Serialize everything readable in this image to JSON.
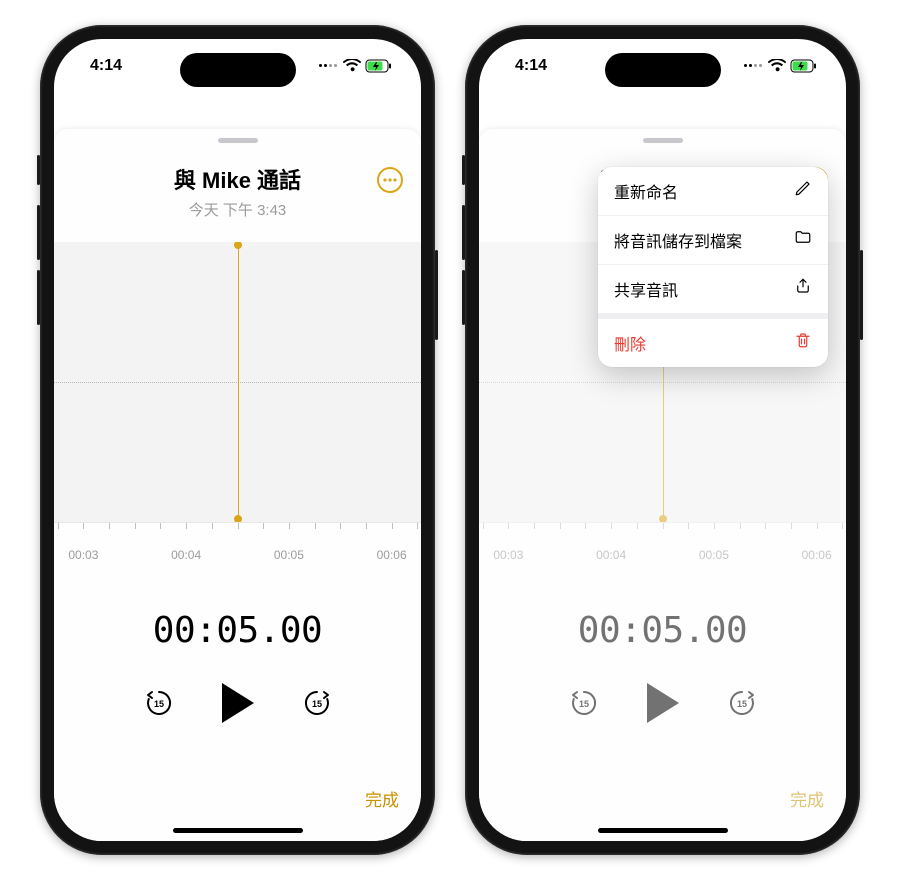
{
  "status": {
    "time": "4:14"
  },
  "recording": {
    "title": "與 Mike 通話",
    "subtitle": "今天 下午 3:43",
    "elapsed": "00:05.00",
    "playhead_tick": "00:05",
    "ticks": [
      "00:03",
      "00:04",
      "00:05",
      "00:06"
    ],
    "tick_positions_pct": [
      8,
      36,
      64,
      92
    ],
    "done_label": "完成",
    "skip_seconds": "15"
  },
  "menu": {
    "rename": "重新命名",
    "save_to_files": "將音訊儲存到檔案",
    "share": "共享音訊",
    "delete": "刪除"
  }
}
